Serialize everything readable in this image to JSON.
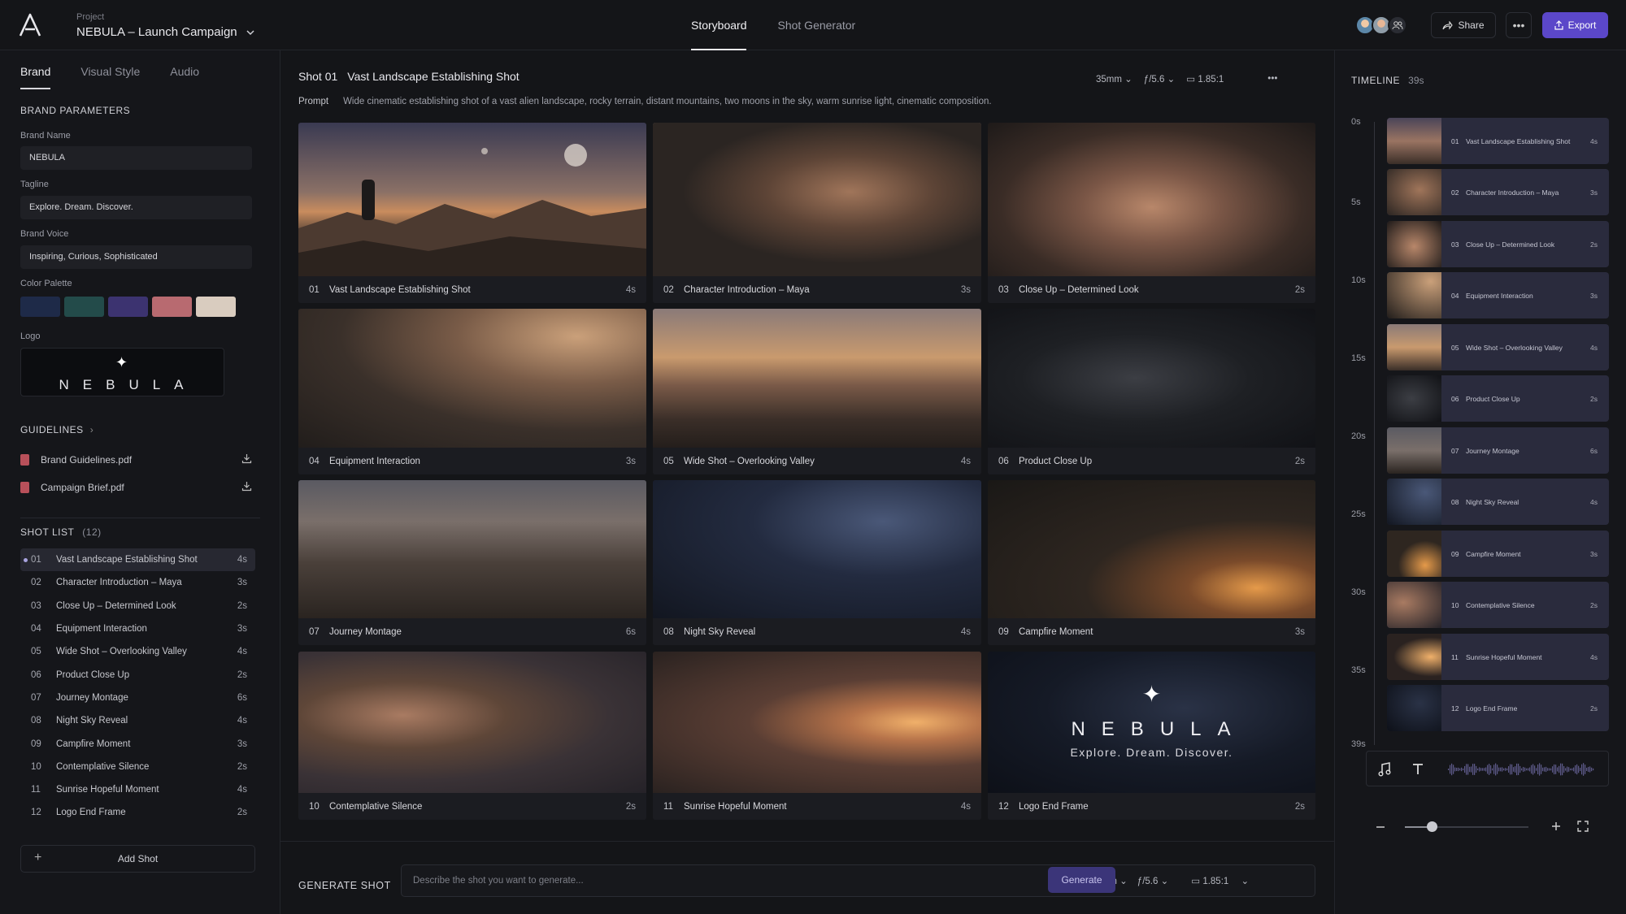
{
  "header": {
    "project_label": "Project",
    "project_name": "NEBULA – Launch Campaign",
    "tabs": [
      {
        "label": "Storyboard",
        "active": true
      },
      {
        "label": "Shot Generator",
        "active": false
      }
    ],
    "share_label": "Share",
    "export_label": "Export"
  },
  "brand_panel": {
    "tabs": [
      "Brand",
      "Visual Style",
      "Audio"
    ],
    "section_title": "BRAND PARAMETERS",
    "brand_name_label": "Brand Name",
    "brand_name": "NEBULA",
    "tagline_label": "Tagline",
    "tagline": "Explore. Dream. Discover.",
    "brand_voice_label": "Brand Voice",
    "brand_voice": "Inspiring, Curious, Sophisticated",
    "color_palette_label": "Color Palette",
    "colors": [
      "#1e2a48",
      "#234b4a",
      "#3c3370",
      "#b86a70",
      "#d9ccbf"
    ],
    "logo_label": "Logo",
    "logo_text": "NEBULA",
    "guidelines_title": "GUIDELINES",
    "guidelines": [
      "Brand Guidelines.pdf",
      "Campaign Brief.pdf"
    ]
  },
  "shot_list": {
    "title": "SHOT LIST",
    "count": "(12)",
    "add_label": "Add Shot",
    "items": [
      {
        "num": "01",
        "title": "Vast Landscape Establishing Shot",
        "dur": "4s",
        "active": true
      },
      {
        "num": "02",
        "title": "Character Introduction – Maya",
        "dur": "3s"
      },
      {
        "num": "03",
        "title": "Close Up – Determined Look",
        "dur": "2s"
      },
      {
        "num": "04",
        "title": "Equipment Interaction",
        "dur": "3s"
      },
      {
        "num": "05",
        "title": "Wide Shot – Overlooking Valley",
        "dur": "4s"
      },
      {
        "num": "06",
        "title": "Product Close Up",
        "dur": "2s"
      },
      {
        "num": "07",
        "title": "Journey Montage",
        "dur": "6s"
      },
      {
        "num": "08",
        "title": "Night Sky Reveal",
        "dur": "4s"
      },
      {
        "num": "09",
        "title": "Campfire Moment",
        "dur": "3s"
      },
      {
        "num": "10",
        "title": "Contemplative Silence",
        "dur": "2s"
      },
      {
        "num": "11",
        "title": "Sunrise Hopeful Moment",
        "dur": "4s"
      },
      {
        "num": "12",
        "title": "Logo End Frame",
        "dur": "2s"
      }
    ]
  },
  "main": {
    "shot_label": "Shot 01",
    "shot_title": "Vast Landscape Establishing Shot",
    "lens": "35mm",
    "aperture": "/5.6",
    "ratio": "1.85:1",
    "prompt_label": "Prompt",
    "prompt": "Wide cinematic establishing shot of a vast alien landscape, rocky terrain, distant mountains, two moons in the sky, warm sunrise light, cinematic composition.",
    "end_frame_title": "NEBULA",
    "end_frame_tagline": "Explore. Dream. Discover."
  },
  "generate": {
    "title": "GENERATE SHOT",
    "placeholder": "Describe the shot you want to generate...",
    "lens": "35mm",
    "aperture": "/5.6",
    "ratio": "1.85:1",
    "button": "Generate"
  },
  "timeline": {
    "title": "TIMELINE",
    "duration": "39s",
    "ticks": [
      "0s",
      "5s",
      "10s",
      "15s",
      "20s",
      "25s",
      "30s",
      "35s",
      "39s"
    ],
    "zoom_level": 0.22
  }
}
